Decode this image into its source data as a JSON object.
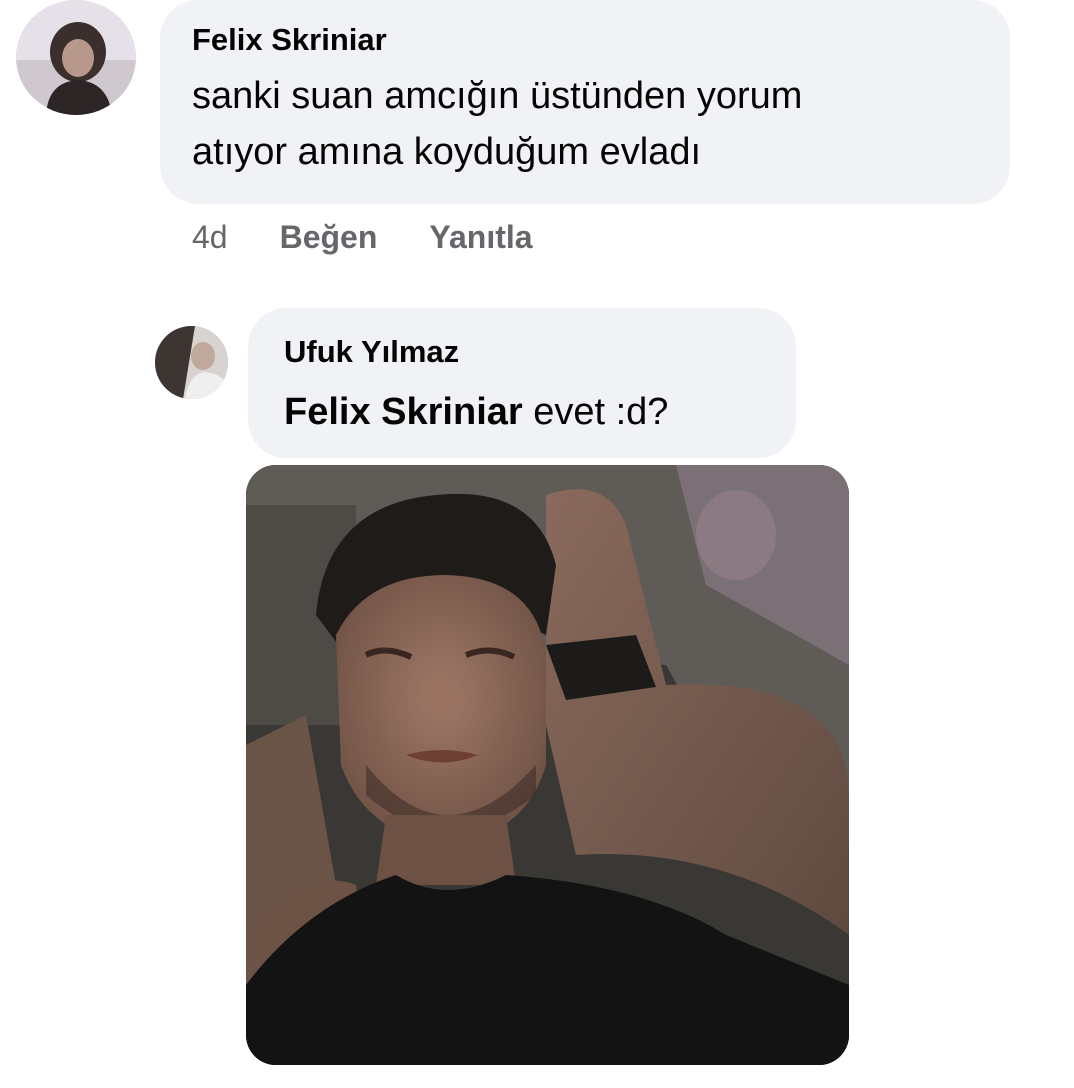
{
  "comment": {
    "author": "Felix Skriniar",
    "lines": [
      "sanki suan amcığın üstünden yorum",
      "atıyor amına koyduğum evladı"
    ],
    "time": "4d",
    "like_label": "Beğen",
    "reply_label": "Yanıtla"
  },
  "reply": {
    "author": "Ufuk Yılmaz",
    "mention": "Felix Skriniar",
    "text": " evet :d?"
  },
  "colors": {
    "bubble": "#f0f2f5",
    "meta_text": "#65676b",
    "text": "#050505"
  }
}
